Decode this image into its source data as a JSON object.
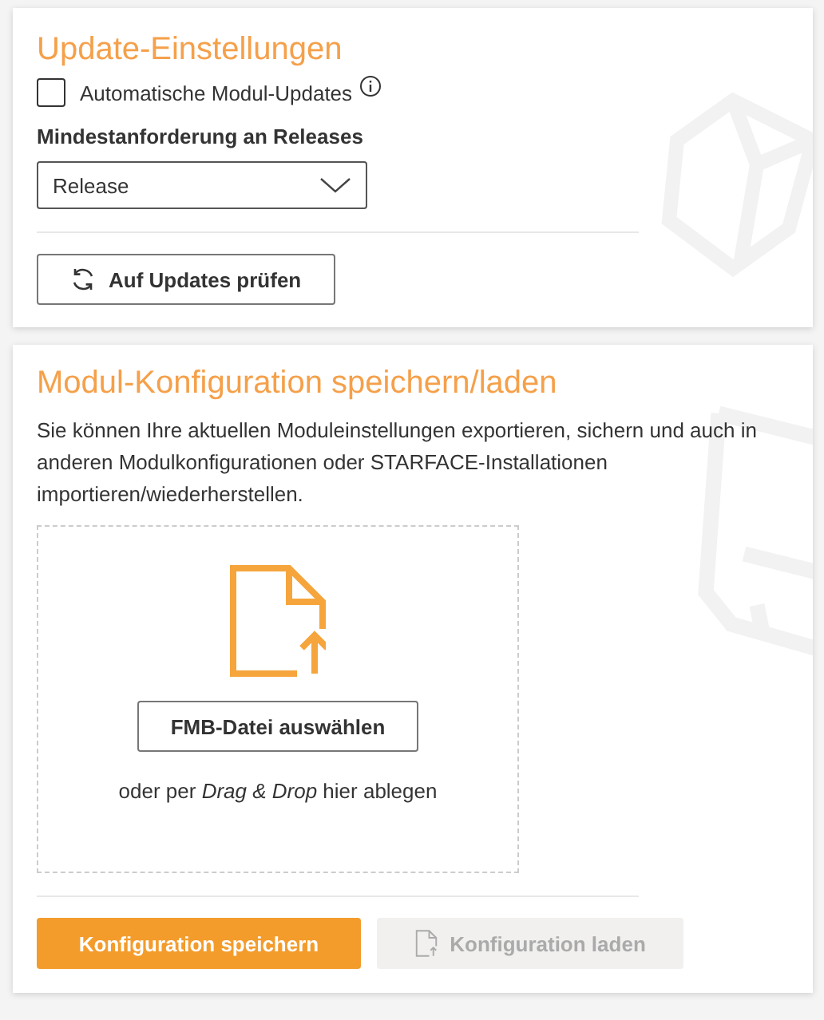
{
  "update_settings": {
    "title": "Update-Einstellungen",
    "auto_updates": {
      "label": "Automatische Modul-Updates",
      "checked": false
    },
    "min_release": {
      "label": "Mindestanforderung an Releases",
      "value": "Release"
    },
    "check_button": {
      "label": "Auf Updates prüfen"
    }
  },
  "module_config": {
    "title": "Modul-Konfiguration speichern/laden",
    "description": "Sie können Ihre aktuellen Moduleinstellungen exportieren, sichern und auch in anderen Modulkonfigurationen oder STARFACE-Installationen importieren/wiederherstellen.",
    "dropzone": {
      "button": "FMB-Datei auswählen",
      "hint": "oder per *Drag & Drop* hier ablegen"
    },
    "buttons": [
      {
        "label": "Konfiguration speichern",
        "kind": "primary",
        "disabled": false
      },
      {
        "label": "Konfiguration laden",
        "kind": "upload",
        "disabled": true
      }
    ]
  }
}
